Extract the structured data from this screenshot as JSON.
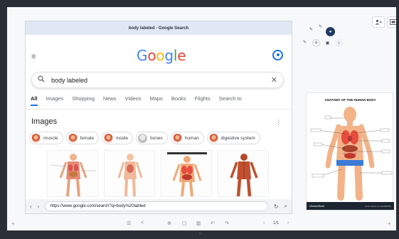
{
  "browser": {
    "window_title": "body labeled - Google Search",
    "url": "https://www.google.com/search?q=body%20labled"
  },
  "google": {
    "logo": [
      {
        "ch": "G",
        "color": "#4285F4"
      },
      {
        "ch": "o",
        "color": "#EA4335"
      },
      {
        "ch": "o",
        "color": "#FBBC05"
      },
      {
        "ch": "g",
        "color": "#4285F4"
      },
      {
        "ch": "l",
        "color": "#34A853"
      },
      {
        "ch": "e",
        "color": "#EA4335"
      }
    ],
    "search_query": "body labeled",
    "tabs": [
      "All",
      "Images",
      "Shopping",
      "News",
      "Videos",
      "Maps",
      "Books",
      "Flights",
      "Search to"
    ],
    "active_tab": "All",
    "images_heading": "Images",
    "chips": [
      "muscle",
      "female",
      "inside",
      "bones",
      "human",
      "digestive system"
    ]
  },
  "poster": {
    "title": "ANATOMY OF THE HUMAN BODY",
    "brand": "VectorStock",
    "credit": "VectorStock.com/32596543"
  },
  "board": {
    "page_indicator": "1/1"
  },
  "colors": {
    "accent": "#1a73e8",
    "titlebar": "#dfe8f3"
  }
}
